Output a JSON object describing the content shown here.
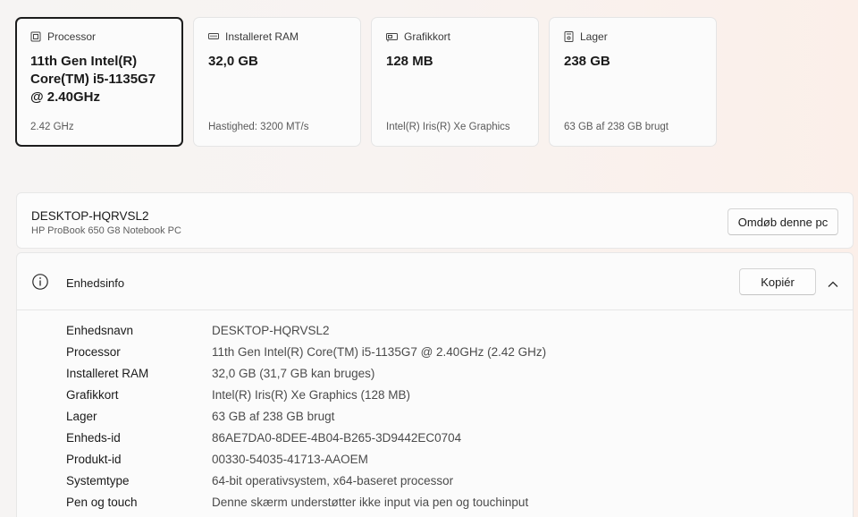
{
  "cards": [
    {
      "title": "Processor",
      "value": "11th Gen Intel(R) Core(TM) i5-1135G7 @ 2.40GHz",
      "footer": "2.42 GHz",
      "icon": "processor-icon"
    },
    {
      "title": "Installeret RAM",
      "value": "32,0 GB",
      "footer": "Hastighed: 3200 MT/s",
      "icon": "ram-icon"
    },
    {
      "title": "Grafikkort",
      "value": "128 MB",
      "footer": "Intel(R) Iris(R) Xe Graphics",
      "icon": "graphics-card-icon"
    },
    {
      "title": "Lager",
      "value": "238 GB",
      "footer": "63 GB af 238 GB brugt",
      "icon": "storage-icon"
    }
  ],
  "device": {
    "name": "DESKTOP-HQRVSL2",
    "model": "HP ProBook 650 G8 Notebook PC",
    "rename_label": "Omdøb denne pc"
  },
  "device_info": {
    "title": "Enhedsinfo",
    "copy_label": "Kopiér",
    "rows": [
      {
        "label": "Enhedsnavn",
        "value": "DESKTOP-HQRVSL2"
      },
      {
        "label": "Processor",
        "value": "11th Gen Intel(R) Core(TM) i5-1135G7 @ 2.40GHz (2.42 GHz)"
      },
      {
        "label": "Installeret RAM",
        "value": "32,0 GB (31,7 GB kan bruges)"
      },
      {
        "label": "Grafikkort",
        "value": "Intel(R) Iris(R) Xe Graphics (128 MB)"
      },
      {
        "label": "Lager",
        "value": "63 GB af 238 GB brugt"
      },
      {
        "label": "Enheds-id",
        "value": "86AE7DA0-8DEE-4B04-B265-3D9442EC0704"
      },
      {
        "label": "Produkt-id",
        "value": "00330-54035-41713-AAOEM"
      },
      {
        "label": "Systemtype",
        "value": "64-bit operativsystem, x64-baseret processor"
      },
      {
        "label": "Pen og touch",
        "value": "Denne skærm understøtter ikke input via pen og touchinput"
      }
    ]
  }
}
